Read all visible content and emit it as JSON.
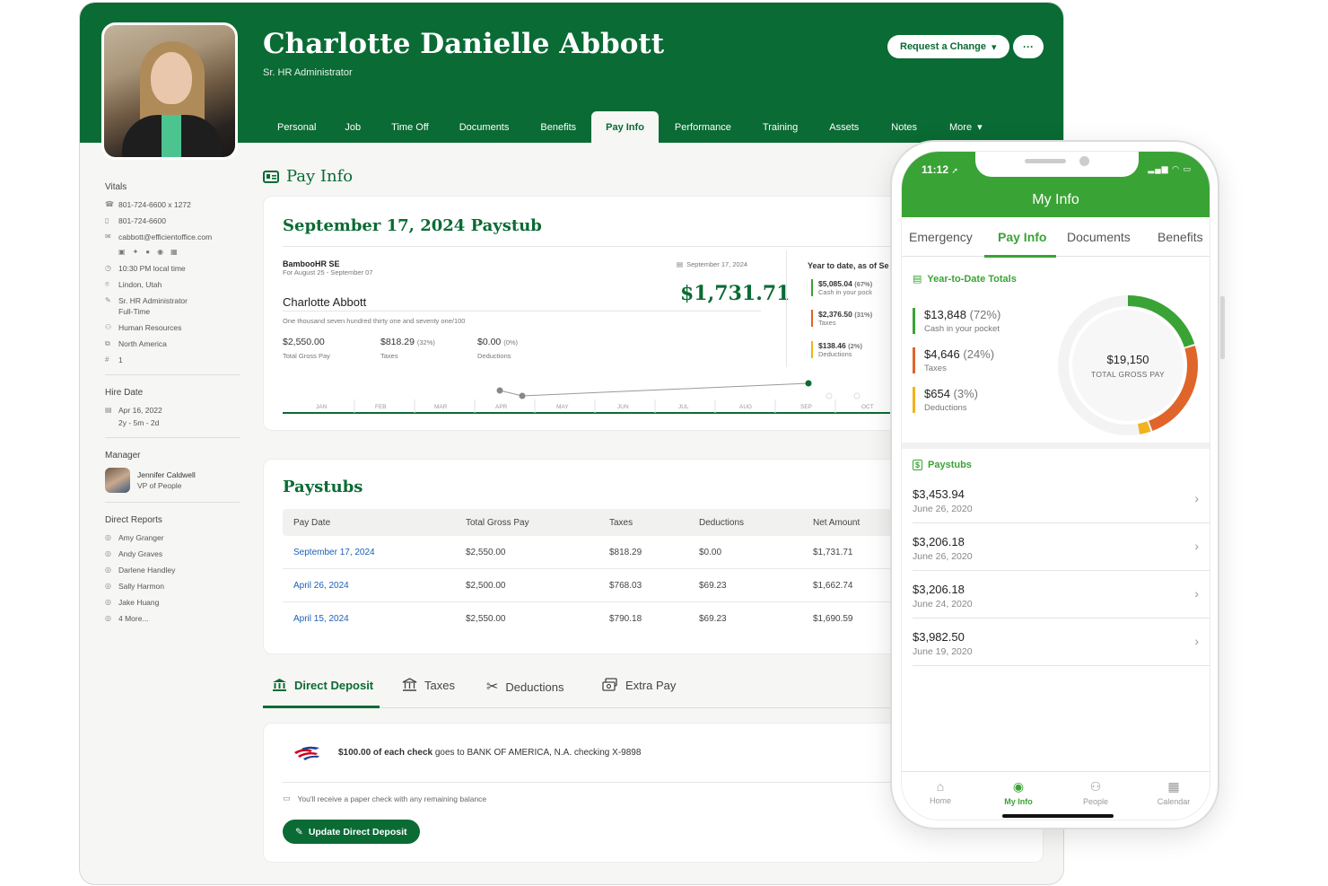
{
  "header": {
    "name": "Charlotte Danielle Abbott",
    "title": "Sr. HR Administrator",
    "request_change": "Request a Change",
    "more_dots": "···",
    "tabs": [
      "Personal",
      "Job",
      "Time Off",
      "Documents",
      "Benefits",
      "Pay Info",
      "Performance",
      "Training",
      "Assets",
      "Notes",
      "More"
    ],
    "active_tab": "Pay Info"
  },
  "sidebar": {
    "vitals_heading": "Vitals",
    "vitals": [
      {
        "icon": "phone-icon",
        "text": "801-724-6600 x 1272"
      },
      {
        "icon": "mobile-icon",
        "text": "801-724-6600"
      },
      {
        "icon": "mail-icon",
        "text": "cabbott@efficientoffice.com"
      },
      {
        "icon": "clock-icon",
        "text": "10:30 PM local time"
      },
      {
        "icon": "location-icon",
        "text": "Lindon, Utah"
      },
      {
        "icon": "briefcase-icon",
        "text": "Sr. HR Administrator"
      },
      {
        "icon": "",
        "text": "Full-Time"
      },
      {
        "icon": "people-icon",
        "text": "Human Resources"
      },
      {
        "icon": "sitemap-icon",
        "text": "North America"
      },
      {
        "icon": "hash-icon",
        "text": "1"
      }
    ],
    "hire_heading": "Hire Date",
    "hire_date": "Apr 16, 2022",
    "tenure": "2y - 5m - 2d",
    "manager_heading": "Manager",
    "manager_name": "Jennifer Caldwell",
    "manager_title": "VP of People",
    "reports_heading": "Direct Reports",
    "reports": [
      "Amy Granger",
      "Andy Graves",
      "Darlene Handley",
      "Sally Harmon",
      "Jake Huang",
      "4 More..."
    ]
  },
  "pay_info_title": "Pay Info",
  "paystub": {
    "title": "September 17, 2024 Paystub",
    "company": "BambooHR SE",
    "period": "For August 25 - September 07",
    "date": "September 17, 2024",
    "employee": "Charlotte Abbott",
    "net": "$1,731.71",
    "amount_words": "One thousand seven hundred thirty one and seventy one/100",
    "gross": "$2,550.00",
    "gross_label": "Total Gross Pay",
    "taxes": "$818.29",
    "taxes_pct": "(32%)",
    "taxes_label": "Taxes",
    "deductions": "$0.00",
    "deductions_pct": "(0%)",
    "deductions_label": "Deductions",
    "ytd_heading": "Year to date, as of Se",
    "ytd": [
      {
        "value": "$5,085.04",
        "pct": "(67%)",
        "label": "Cash in your pock"
      },
      {
        "value": "$2,376.50",
        "pct": "(31%)",
        "label": "Taxes"
      },
      {
        "value": "$138.46",
        "pct": "(2%)",
        "label": "Deductions"
      }
    ],
    "months": [
      "JAN",
      "FEB",
      "MAR",
      "APR",
      "MAY",
      "JUN",
      "JUL",
      "AUG",
      "SEP",
      "OCT"
    ]
  },
  "paystubs": {
    "title": "Paystubs",
    "columns": [
      "Pay Date",
      "Total Gross Pay",
      "Taxes",
      "Deductions",
      "Net Amount"
    ],
    "rows": [
      [
        "September 17, 2024",
        "$2,550.00",
        "$818.29",
        "$0.00",
        "$1,731.71"
      ],
      [
        "April 26, 2024",
        "$2,500.00",
        "$768.03",
        "$69.23",
        "$1,662.74"
      ],
      [
        "April 15, 2024",
        "$2,550.00",
        "$790.18",
        "$69.23",
        "$1,690.59"
      ]
    ]
  },
  "deposit_tabs": [
    "Direct Deposit",
    "Taxes",
    "Deductions",
    "Extra Pay"
  ],
  "deposit": {
    "amount_bold": "$100.00 of each check",
    "rest": " goes to BANK OF AMERICA, N.A. checking X-9898",
    "paper_note": "You'll receive a paper check with any remaining balance",
    "update_button": "Update Direct Deposit"
  },
  "phone": {
    "time": "11:12",
    "title": "My Info",
    "tabs": [
      "Emergency",
      "Pay Info",
      "Documents",
      "Benefits"
    ],
    "active_tab": "Pay Info",
    "ytd_heading": "Year-to-Date Totals",
    "ytd": [
      {
        "value": "$13,848",
        "pct": "(72%)",
        "label": "Cash in your pocket",
        "color": "#3aa335"
      },
      {
        "value": "$4,646",
        "pct": "(24%)",
        "label": "Taxes",
        "color": "#e0652a"
      },
      {
        "value": "$654",
        "pct": "(3%)",
        "label": "Deductions",
        "color": "#f2b21c"
      }
    ],
    "donut_value": "$19,150",
    "donut_label": "TOTAL GROSS PAY",
    "paystubs_heading": "Paystubs",
    "paystubs": [
      {
        "amount": "$3,453.94",
        "date": "June 26, 2020"
      },
      {
        "amount": "$3,206.18",
        "date": "June 26, 2020"
      },
      {
        "amount": "$3,206.18",
        "date": "June 24, 2020"
      },
      {
        "amount": "$3,982.50",
        "date": "June 19, 2020"
      }
    ],
    "nav": [
      "Home",
      "My Info",
      "People",
      "Calendar"
    ],
    "active_nav": "My Info"
  },
  "colors": {
    "brand_green": "#0a6b34",
    "mobile_green": "#3aa335",
    "tax_orange": "#e0652a",
    "deduction_yellow": "#f2b21c",
    "link_blue": "#1c5fb8"
  }
}
